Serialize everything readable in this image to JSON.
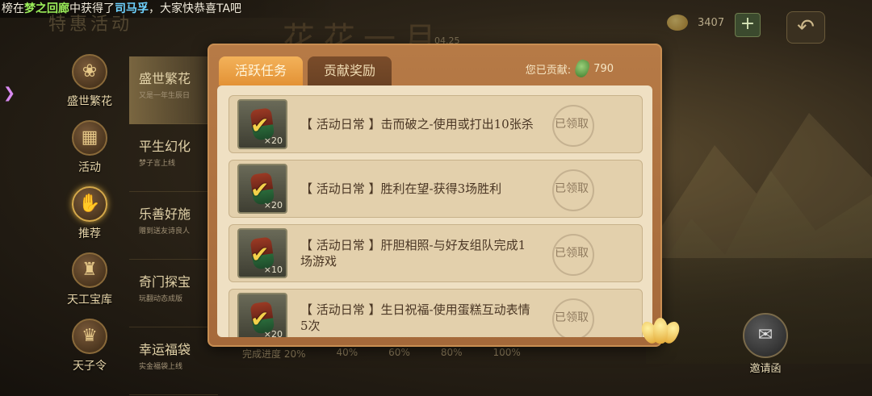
{
  "broadcast": {
    "prefix": "榜",
    "word1": "在",
    "place": "梦之回廊",
    "word2": "中获得了",
    "item": "司马孚",
    "suffix": "，大家快恭喜TA吧"
  },
  "header": {
    "page_title": "特惠活动",
    "bg_title": "花花一月",
    "bg_date": "04.25",
    "currency_amount": "3407",
    "add_label": "+",
    "back_label": "↶"
  },
  "sidebar": {
    "items": [
      {
        "label": "盛世繁花",
        "icon": "rose-icon",
        "glyph": "❀"
      },
      {
        "label": "活动",
        "icon": "gift-icon",
        "glyph": "▦"
      },
      {
        "label": "推荐",
        "icon": "thumbs-up-icon",
        "glyph": "✋"
      },
      {
        "label": "天工宝库",
        "icon": "treasure-icon",
        "glyph": "♜"
      },
      {
        "label": "天子令",
        "icon": "token-icon",
        "glyph": "♛"
      }
    ]
  },
  "categories": [
    {
      "title": "盛世繁花",
      "sub": "又是一年生辰日"
    },
    {
      "title": "平生幻化",
      "sub": "梦子言上线"
    },
    {
      "title": "乐善好施",
      "sub": "赠到送友诗良人"
    },
    {
      "title": "奇门探宝",
      "sub": "玩翻动态成版"
    },
    {
      "title": "幸运福袋",
      "sub": "实金福袋上线"
    }
  ],
  "progress_labels": [
    "完成进度 20%",
    "40%",
    "60%",
    "80%",
    "100%"
  ],
  "invite": {
    "label": "邀请函",
    "glyph": "✉"
  },
  "modal": {
    "tabs": [
      "活跃任务",
      "贡献奖励"
    ],
    "contribution_label": "您已贡献:",
    "contribution_value": "790",
    "tasks": [
      {
        "text": "【 活动日常 】击而破之-使用或打出10张杀",
        "qty": "×20",
        "status": "已领取"
      },
      {
        "text": "【 活动日常 】胜利在望-获得3场胜利",
        "qty": "×20",
        "status": "已领取"
      },
      {
        "text": "【 活动日常 】肝胆相照-与好友组队完成1场游戏",
        "qty": "×10",
        "status": "已领取"
      },
      {
        "text": "【 活动日常 】生日祝福-使用蛋糕互动表情5次",
        "qty": "×20",
        "status": "已领取"
      }
    ]
  }
}
